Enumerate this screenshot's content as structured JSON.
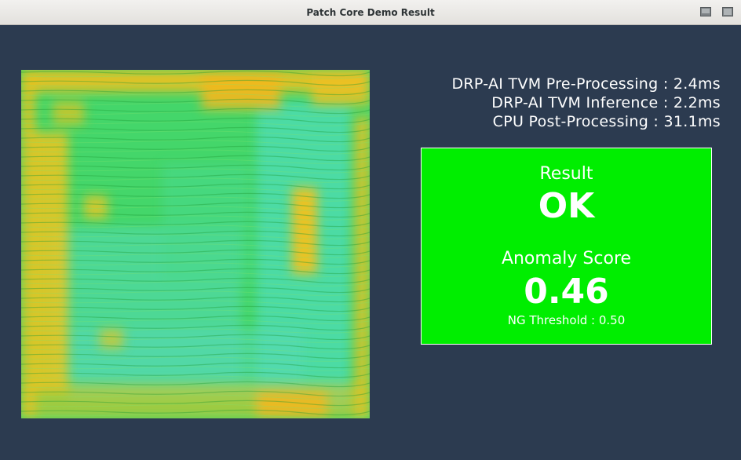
{
  "window": {
    "title": "Patch Core Demo Result",
    "minimize_icon": "minimize-icon",
    "maximize_icon": "maximize-icon"
  },
  "heatmap": {
    "description_icon": "anomaly-heatmap-image"
  },
  "timings": {
    "preprocessing": "DRP-AI TVM Pre-Processing : 2.4ms",
    "inference": "DRP-AI TVM Inference : 2.2ms",
    "postprocessing": "CPU Post-Processing : 31.1ms"
  },
  "result": {
    "label": "Result",
    "value": "OK",
    "score_label": "Anomaly Score",
    "score_value": "0.46",
    "threshold": "NG Threshold : 0.50",
    "box_color": "#00ee00"
  },
  "colors": {
    "background": "#2c3b50",
    "text": "#ffffff"
  }
}
